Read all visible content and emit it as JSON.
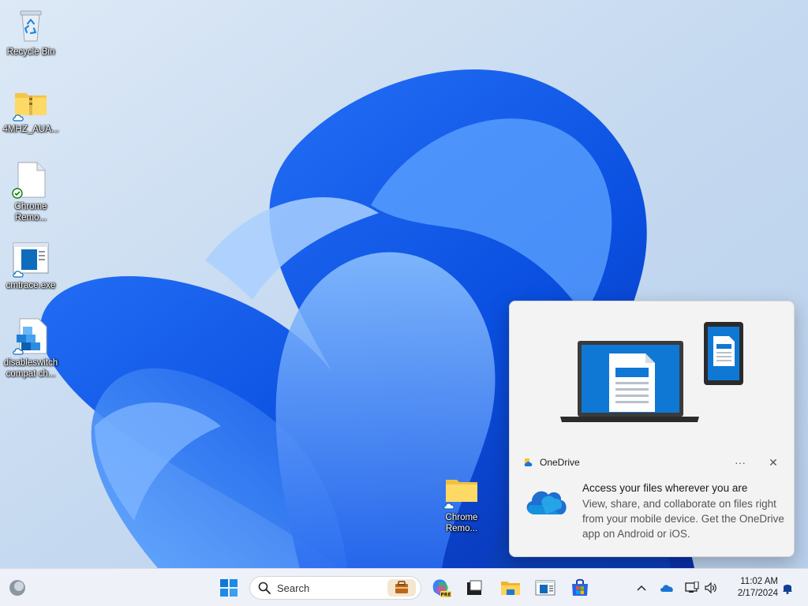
{
  "desktop": {
    "icons": [
      {
        "label": "Recycle Bin",
        "icon": "recycle-bin-icon"
      },
      {
        "label": "4MHZ_AUA...",
        "icon": "zip-folder-icon"
      },
      {
        "label": "Chrome Remo...",
        "icon": "document-icon"
      },
      {
        "label": "cmtrace.exe",
        "icon": "app-window-icon"
      },
      {
        "label": "disableswitch compat ch...",
        "icon": "msi-package-icon"
      },
      {
        "label": "Chrome Remo...",
        "icon": "folder-icon"
      }
    ]
  },
  "toast": {
    "app_name": "OneDrive",
    "more_glyph": "···",
    "close_glyph": "✕",
    "title": "Access your files wherever you are",
    "message": "View, share, and collaborate on files right from your mobile device. Get the OneDrive app on Android or iOS."
  },
  "taskbar": {
    "search_placeholder": "Search",
    "pinned": [
      "start-icon",
      "copilot-icon",
      "terminal-icon",
      "file-explorer-icon",
      "window-app-icon",
      "store-icon"
    ],
    "tray_chevron": "^",
    "clock": {
      "time": "11:02 AM",
      "date": "2/17/2024"
    }
  },
  "colors": {
    "accent": "#0078d4",
    "taskbar_bg": "#eef2f8",
    "toast_bg": "#f3f3f3"
  }
}
